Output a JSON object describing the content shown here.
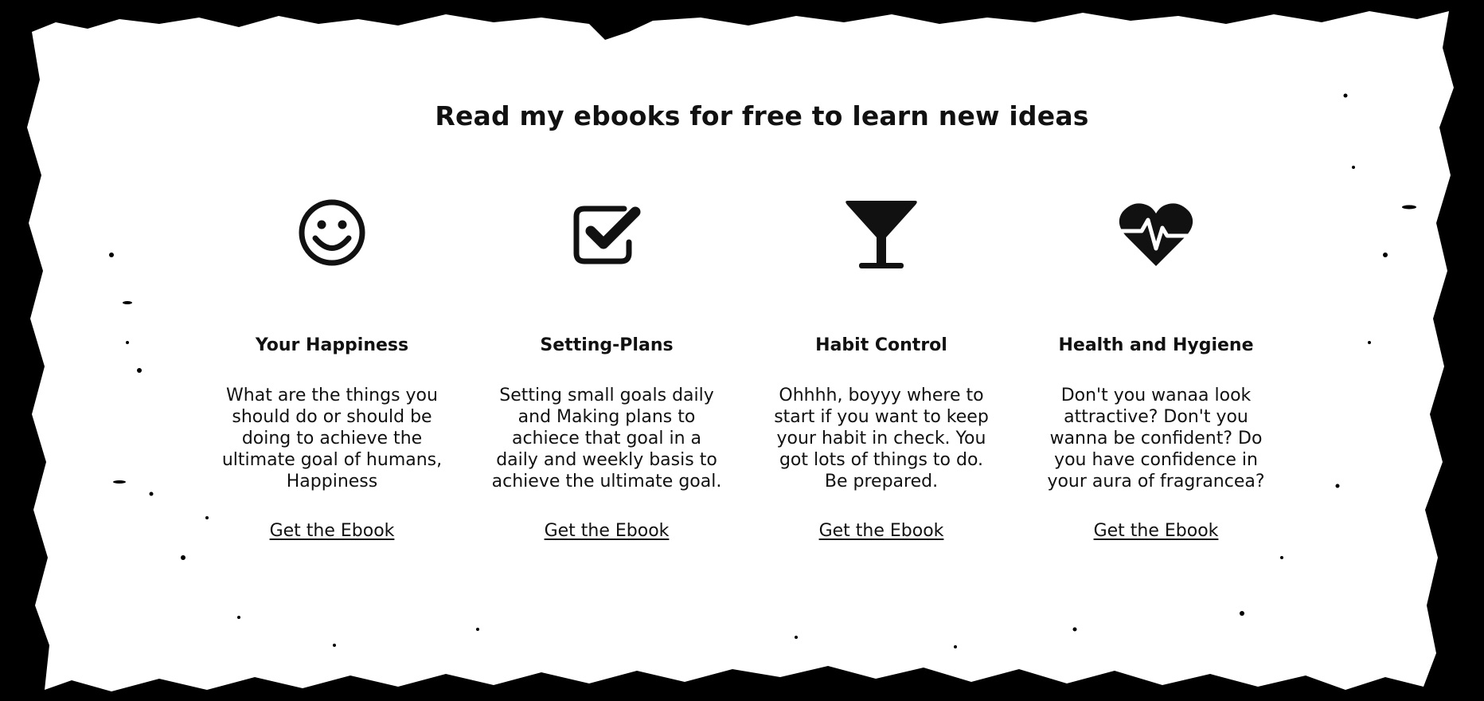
{
  "headline": "Read my ebooks for free to learn new ideas",
  "colors": {
    "frame": "#000000",
    "paper": "#ffffff",
    "text": "#111111"
  },
  "cards": [
    {
      "icon": "smiley-face-icon",
      "title": "Your Happiness",
      "description": "What are the things you should do or should be doing to achieve the ultimate goal of humans, Happiness",
      "link": "Get the Ebook"
    },
    {
      "icon": "checkbox-check-icon",
      "title": "Setting-Plans",
      "description": "Setting small goals daily and Making plans to achiece that goal in a daily and weekly basis to achieve the ultimate goal.",
      "link": "Get the Ebook"
    },
    {
      "icon": "cocktail-glass-icon",
      "title": "Habit Control",
      "description": "Ohhhh, boyyy where to start if you want to keep your habit in check. You got lots of things to do. Be prepared.",
      "link": "Get the Ebook"
    },
    {
      "icon": "heartbeat-icon",
      "title": "Health and Hygiene",
      "description": "Don't you wanaa look attractive? Don't you wanna be confident? Do you have confidence in your aura of fragrancea?",
      "link": "Get the Ebook"
    }
  ]
}
